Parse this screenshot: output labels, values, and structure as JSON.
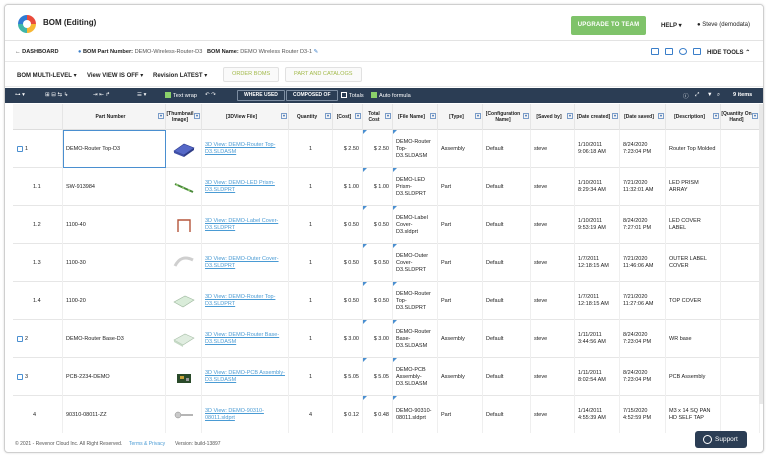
{
  "app": {
    "title": "BOM (Editing)",
    "upgrade_label": "UPGRADE TO TEAM",
    "help_label": "HELP",
    "user_label": "Steve (demodata)"
  },
  "nav": {
    "back_label": "DASHBOARD",
    "part_number_label": "BOM Part Number:",
    "part_number_value": "DEMO-Wireless-Router-D3",
    "name_label": "BOM Name:",
    "name_value": "DEMO Wireless Router D3-1",
    "hide_tools": "HIDE TOOLS"
  },
  "controls": {
    "bom_label": "BOM",
    "bom_value": "MULTI-LEVEL",
    "view_label": "View",
    "view_value": "VIEW IS OFF",
    "revision_label": "Revision",
    "revision_value": "LATEST",
    "tab_order": "ORDER BOMS",
    "tab_catalog": "PART AND CATALOGS"
  },
  "toolbar": {
    "text_wrap": "Text wrap",
    "where_used": "WHERE USED",
    "composed_of": "COMPOSED OF",
    "totals": "Totals",
    "auto_formula": "Auto formula",
    "items_count": "9 items"
  },
  "columns": [
    "Part Number",
    "[Thumbnail Image]",
    "[3DView File]",
    "Quantity",
    "[Cost]",
    "Total Cost",
    "[File Name]",
    "[Type]",
    "[Configuration Name]",
    "[Saved by]",
    "[Date created]",
    "[Date saved]",
    "[Description]",
    "[Quantity On Hand]"
  ],
  "rows": [
    {
      "level": "1",
      "has_check": true,
      "part": "DEMO-Router Top-D3",
      "view_file": "3D View: DEMO-Router Top-D3.SLDASM",
      "qty": "1",
      "cost": "$ 2.50",
      "total": "$ 2.50",
      "file": "DEMO-Router Top-D3.SLDASM",
      "type": "Assembly",
      "config": "Default",
      "saved_by": "steve",
      "created": "1/10/2011 9:06:18 AM",
      "saved": "8/24/2020 7:23:04 PM",
      "desc": "Router Top Molded"
    },
    {
      "level": "1.1",
      "has_check": false,
      "part": "SW-913984",
      "view_file": "3D View: DEMO-LED Prism-D3.SLDPRT",
      "qty": "1",
      "cost": "$ 1.00",
      "total": "$ 1.00",
      "file": "DEMO-LED Prism-D3.SLDPRT",
      "type": "Part",
      "config": "Default",
      "saved_by": "steve",
      "created": "1/10/2011 8:29:34 AM",
      "saved": "7/21/2020 11:32:01 AM",
      "desc": "LED PRISM ARRAY"
    },
    {
      "level": "1.2",
      "has_check": false,
      "part": "1100-40",
      "view_file": "3D View: DEMO-Label Cover-D3.SLDPRT",
      "qty": "1",
      "cost": "$ 0.50",
      "total": "$ 0.50",
      "file": "DEMO-Label Cover-D3.sldprt",
      "type": "Part",
      "config": "Default",
      "saved_by": "steve",
      "created": "1/10/2011 9:53:19 AM",
      "saved": "8/24/2020 7:27:01 PM",
      "desc": "LED COVER LABEL"
    },
    {
      "level": "1.3",
      "has_check": false,
      "part": "1100-30",
      "view_file": "3D View: DEMO-Outer Cover-D3.SLDPRT",
      "qty": "1",
      "cost": "$ 0.50",
      "total": "$ 0.50",
      "file": "DEMO-Outer Cover-D3.SLDPRT",
      "type": "Part",
      "config": "Default",
      "saved_by": "steve",
      "created": "1/7/2011 12:18:15 AM",
      "saved": "7/21/2020 11:46:06 AM",
      "desc": "OUTER LABEL COVER"
    },
    {
      "level": "1.4",
      "has_check": false,
      "part": "1100-20",
      "view_file": "3D View: DEMO-Router Top-D3.SLDPRT",
      "qty": "1",
      "cost": "$ 0.50",
      "total": "$ 0.50",
      "file": "DEMO-Router Top-D3.SLDPRT",
      "type": "Part",
      "config": "Default",
      "saved_by": "steve",
      "created": "1/7/2011 12:18:15 AM",
      "saved": "7/21/2020 11:27:06 AM",
      "desc": "TOP COVER"
    },
    {
      "level": "2",
      "has_check": true,
      "part": "DEMO-Router Base-D3",
      "view_file": "3D View: DEMO-Router Base-D3.SLDASM",
      "qty": "1",
      "cost": "$ 3.00",
      "total": "$ 3.00",
      "file": "DEMO-Router Base-D3.SLDASM",
      "type": "Assembly",
      "config": "Default",
      "saved_by": "steve",
      "created": "1/11/2011 3:44:56 AM",
      "saved": "8/24/2020 7:23:04 PM",
      "desc": "WR base"
    },
    {
      "level": "3",
      "has_check": true,
      "part": "PCB-2234-DEMO",
      "view_file": "3D View: DEMO-PCB Assembly-D3.SLDASM",
      "qty": "1",
      "cost": "$ 5.05",
      "total": "$ 5.05",
      "file": "DEMO-PCB Assembly-D3.SLDASM",
      "type": "Assembly",
      "config": "Default",
      "saved_by": "steve",
      "created": "1/11/2011 8:02:54 AM",
      "saved": "8/24/2020 7:23:04 PM",
      "desc": "PCB Assembly"
    },
    {
      "level": "4",
      "has_check": false,
      "part": "90310-08011-ZZ",
      "view_file": "3D View: DEMO-90310-08011.sldprt",
      "qty": "4",
      "cost": "$ 0.12",
      "total": "$ 0.48",
      "file": "DEMO-90310-08011.sldprt",
      "type": "Part",
      "config": "Default",
      "saved_by": "steve",
      "created": "1/14/2011 4:55:39 AM",
      "saved": "7/15/2020 4:52:59 PM",
      "desc": "M3 x 14 SQ PAN HD SELF TAP"
    }
  ],
  "footer": {
    "copyright": "© 2021 - Revenor Cloud Inc. All Right Reserved.",
    "terms": "Terms & Privacy",
    "version": "Version: build-13897",
    "support": "Support"
  },
  "colors": {
    "toolbar_bg": "#2b3d54",
    "upgrade_bg": "#7fc36a",
    "link": "#4a9bd4"
  }
}
